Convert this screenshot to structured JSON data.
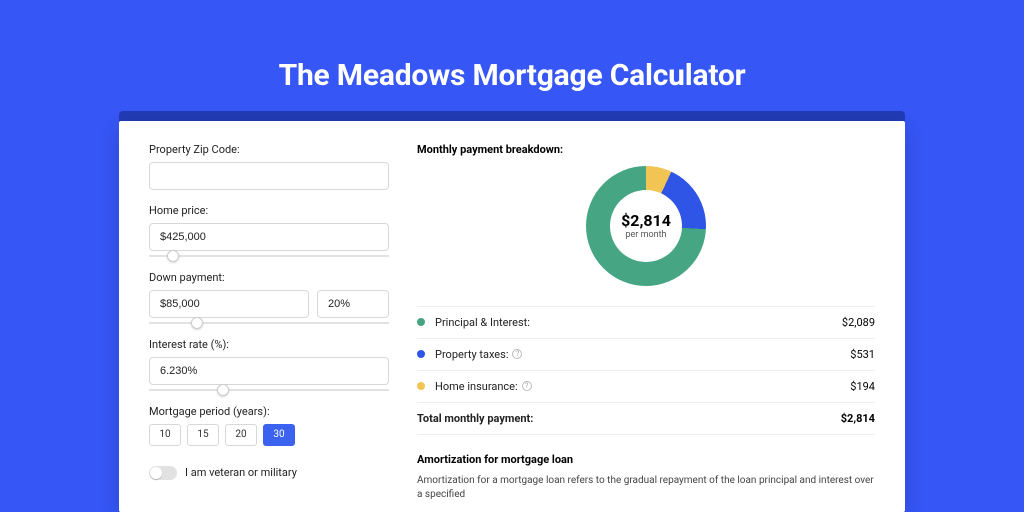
{
  "page": {
    "title": "The Meadows Mortgage Calculator"
  },
  "inputs": {
    "zip_label": "Property Zip Code:",
    "zip_value": "",
    "home_price_label": "Home price:",
    "home_price_value": "$425,000",
    "down_payment_label": "Down payment:",
    "down_payment_amount": "$85,000",
    "down_payment_pct": "20%",
    "interest_label": "Interest rate (%):",
    "interest_value": "6.230%",
    "period_label": "Mortgage period (years):",
    "periods": [
      "10",
      "15",
      "20",
      "30"
    ],
    "period_selected": "30",
    "veteran_label": "I am veteran or military"
  },
  "breakdown": {
    "title": "Monthly payment breakdown:",
    "donut_amount": "$2,814",
    "donut_sub": "per month",
    "items": [
      {
        "label": "Principal & Interest:",
        "value": "$2,089",
        "color": "#46a583"
      },
      {
        "label": "Property taxes:",
        "value": "$531",
        "color": "#2f55e6",
        "help": true
      },
      {
        "label": "Home insurance:",
        "value": "$194",
        "color": "#f1c453",
        "help": true
      }
    ],
    "total_label": "Total monthly payment:",
    "total_value": "$2,814"
  },
  "amortization": {
    "title": "Amortization for mortgage loan",
    "text": "Amortization for a mortgage loan refers to the gradual repayment of the loan principal and interest over a specified"
  },
  "chart_data": {
    "type": "pie",
    "title": "Monthly payment breakdown",
    "categories": [
      "Principal & Interest",
      "Property taxes",
      "Home insurance"
    ],
    "values": [
      2089,
      531,
      194
    ],
    "total": 2814,
    "colors": [
      "#46a583",
      "#2f55e6",
      "#f1c453"
    ]
  }
}
